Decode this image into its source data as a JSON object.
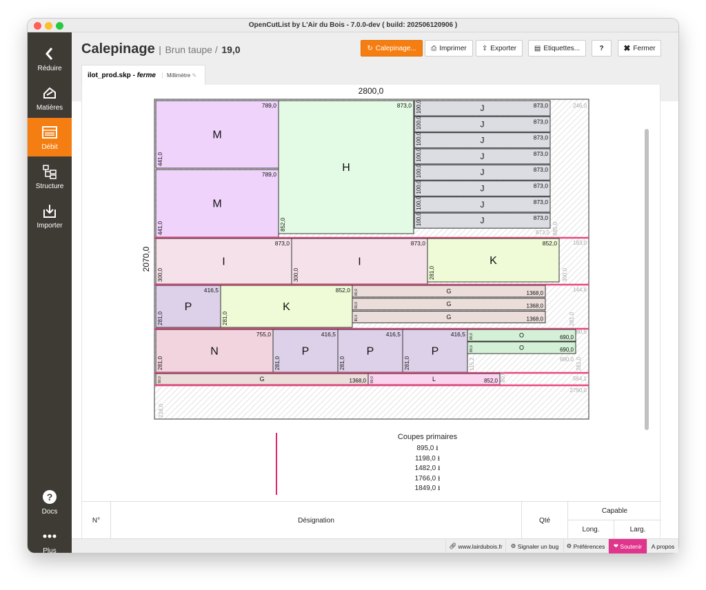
{
  "window": {
    "title": "OpenCutList by L'Air du Bois - 7.0.0-dev ( build: 202506120906 )"
  },
  "sidebar": {
    "items": [
      {
        "label": "Réduire",
        "icon": "chevron-left-icon"
      },
      {
        "label": "Matières",
        "icon": "materials-icon"
      },
      {
        "label": "Débit",
        "icon": "cutlist-icon",
        "active": true
      },
      {
        "label": "Structure",
        "icon": "structure-icon"
      },
      {
        "label": "Importer",
        "icon": "import-icon"
      },
      {
        "label": "Docs",
        "icon": "help-circle-icon"
      },
      {
        "label": "Plus",
        "icon": "more-dots-icon"
      }
    ]
  },
  "header": {
    "title": "Calepinage",
    "separator": "|",
    "material": "Brun taupe /",
    "thickness": "19,0",
    "buttons": {
      "calepinage": "Calepinage...",
      "print": "Imprimer",
      "export": "Exporter",
      "labels": "Etiquettes...",
      "help": "?",
      "close": "Fermer"
    }
  },
  "tab": {
    "file": "ilot_prod.skp",
    "dash": "-",
    "variant": "ferme",
    "unit": "Millimètre"
  },
  "sheet": {
    "width_label": "2800,0",
    "height_label": "2070,0"
  },
  "parts": [
    {
      "name": "M",
      "length": "789,0",
      "width": "441,0",
      "color": "#efd3fb"
    },
    {
      "name": "M",
      "length": "789,0",
      "width": "441,0",
      "color": "#efd3fb"
    },
    {
      "name": "H",
      "length": "873,0",
      "width": "852,0",
      "color": "#e3fae4"
    },
    {
      "name": "J",
      "length": "873,0",
      "width": "100,0",
      "color": "#dbdde2"
    },
    {
      "name": "I",
      "length": "873,0",
      "width": "300,0",
      "color": "#f5e1e9"
    },
    {
      "name": "K",
      "length": "852,0",
      "width": "281,0",
      "color": "#eefbd6"
    },
    {
      "name": "P",
      "length": "416,5",
      "width": "281,0",
      "color": "#dcd1e8"
    },
    {
      "name": "G",
      "length": "1368,0",
      "width": "80,0",
      "color": "#eaddda"
    },
    {
      "name": "N",
      "length": "755,0",
      "width": "281,0",
      "color": "#f2d4df"
    },
    {
      "name": "O",
      "length": "690,0",
      "width": "80,0",
      "color": "#d4f0d7"
    },
    {
      "name": "L",
      "length": "852,0",
      "width": "80,0",
      "color": "#f9d5ef"
    }
  ],
  "offcuts": [
    "246,0",
    "885,0",
    "873,0",
    "183,0",
    "300,0",
    "144,6",
    "281,0",
    "80,5",
    "690,0",
    "115,2",
    "281,0",
    "564,1",
    "80,0",
    "2790,0",
    "218,0"
  ],
  "primary_cuts": {
    "title": "Coupes primaires",
    "values": [
      "895,0",
      "1198,0",
      "1482,0",
      "1766,0",
      "1849,0"
    ]
  },
  "table": {
    "headers": {
      "num": "N°",
      "designation": "Désignation",
      "qty": "Qté",
      "capable": "Capable",
      "long": "Long.",
      "larg": "Larg."
    }
  },
  "footer": {
    "site": "www.lairdubois.fr",
    "bug": "Signaler un bug",
    "prefs": "Préférences",
    "support": "Soutenir",
    "about": "A propos"
  }
}
